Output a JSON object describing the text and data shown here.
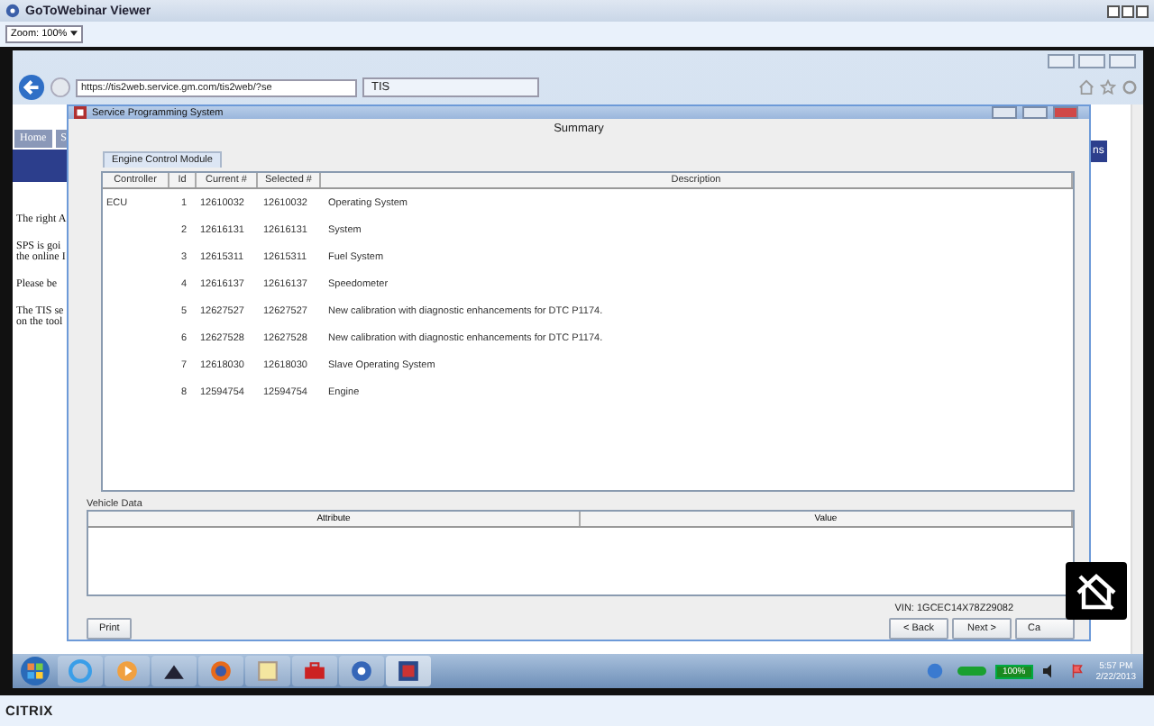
{
  "viewer": {
    "title": "GoToWebinar Viewer",
    "zoom": "Zoom: 100%"
  },
  "browser": {
    "url": "https://tis2web.service.gm.com/tis2web/?se",
    "tab": "TIS"
  },
  "page": {
    "nav": [
      "Home",
      "S"
    ],
    "badge": "ns",
    "paragraphs": [
      [
        "The right A"
      ],
      [
        "SPS is goi",
        "the online I"
      ],
      [
        "Please be"
      ],
      [
        "The TIS se",
        "on the tool"
      ]
    ]
  },
  "dialog": {
    "title": "Service Programming System",
    "heading": "Summary",
    "tab": "Engine Control Module",
    "columns": [
      "Controller",
      "Id",
      "Current #",
      "Selected #",
      "Description"
    ],
    "rows": [
      {
        "controller": "ECU",
        "id": "1",
        "current": "12610032",
        "selected": "12610032",
        "description": "Operating System"
      },
      {
        "controller": "",
        "id": "2",
        "current": "12616131",
        "selected": "12616131",
        "description": "System"
      },
      {
        "controller": "",
        "id": "3",
        "current": "12615311",
        "selected": "12615311",
        "description": "Fuel System"
      },
      {
        "controller": "",
        "id": "4",
        "current": "12616137",
        "selected": "12616137",
        "description": "Speedometer"
      },
      {
        "controller": "",
        "id": "5",
        "current": "12627527",
        "selected": "12627527",
        "description": "New calibration with diagnostic enhancements for DTC P1174."
      },
      {
        "controller": "",
        "id": "6",
        "current": "12627528",
        "selected": "12627528",
        "description": "New calibration with diagnostic enhancements for DTC P1174."
      },
      {
        "controller": "",
        "id": "7",
        "current": "12618030",
        "selected": "12618030",
        "description": "Slave Operating System"
      },
      {
        "controller": "",
        "id": "8",
        "current": "12594754",
        "selected": "12594754",
        "description": "Engine"
      }
    ],
    "vehicle_data": {
      "label": "Vehicle Data",
      "columns": [
        "Attribute",
        "Value"
      ]
    },
    "vin": "VIN: 1GCEC14X78Z29082",
    "print": "Print",
    "nav_buttons": [
      "< Back",
      "Next >",
      "Ca"
    ]
  },
  "taskbar": {
    "battery": "100%",
    "time": "5:57 PM",
    "date": "2/22/2013"
  },
  "footer": "CITRIX"
}
